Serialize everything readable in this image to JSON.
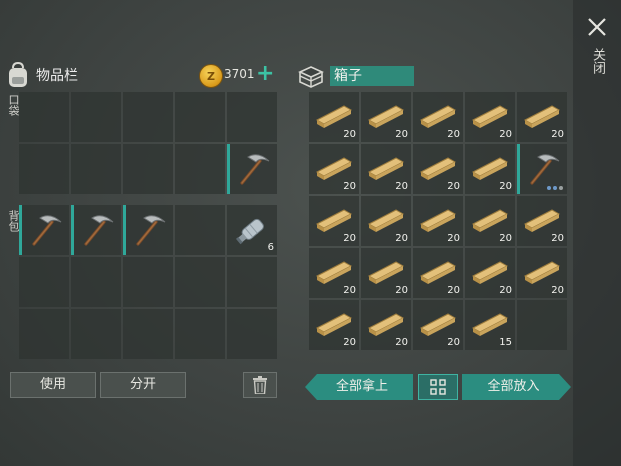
{
  "window": {
    "close_label": "关闭"
  },
  "inventory": {
    "title": "物品栏",
    "coins": "3701",
    "pocket_label": "口袋",
    "backpack_label": "背包",
    "pocket_slots": [
      {
        "item": ""
      },
      {
        "item": ""
      },
      {
        "item": ""
      },
      {
        "item": ""
      },
      {
        "item": ""
      },
      {
        "item": ""
      },
      {
        "item": ""
      },
      {
        "item": ""
      },
      {
        "item": ""
      },
      {
        "item": "pickaxe",
        "selected": true
      }
    ],
    "backpack_slots": [
      {
        "item": "pickaxe",
        "selected": true
      },
      {
        "item": "pickaxe",
        "selected": true
      },
      {
        "item": "pickaxe",
        "selected": true
      },
      {
        "item": ""
      },
      {
        "item": "water-bottle",
        "qty": "6"
      },
      {
        "item": ""
      },
      {
        "item": ""
      },
      {
        "item": ""
      },
      {
        "item": ""
      },
      {
        "item": ""
      },
      {
        "item": ""
      },
      {
        "item": ""
      },
      {
        "item": ""
      },
      {
        "item": ""
      },
      {
        "item": ""
      }
    ],
    "use_label": "使用",
    "split_label": "分开"
  },
  "chest": {
    "name": "箱子",
    "slots": [
      {
        "item": "plank",
        "qty": "20"
      },
      {
        "item": "plank",
        "qty": "20"
      },
      {
        "item": "plank",
        "qty": "20"
      },
      {
        "item": "plank",
        "qty": "20"
      },
      {
        "item": "plank",
        "qty": "20"
      },
      {
        "item": "plank",
        "qty": "20"
      },
      {
        "item": "plank",
        "qty": "20"
      },
      {
        "item": "plank",
        "qty": "20"
      },
      {
        "item": "plank",
        "qty": "20"
      },
      {
        "item": "pickaxe",
        "selected": true,
        "dots": true
      },
      {
        "item": "plank",
        "qty": "20"
      },
      {
        "item": "plank",
        "qty": "20"
      },
      {
        "item": "plank",
        "qty": "20"
      },
      {
        "item": "plank",
        "qty": "20"
      },
      {
        "item": "plank",
        "qty": "20"
      },
      {
        "item": "plank",
        "qty": "20"
      },
      {
        "item": "plank",
        "qty": "20"
      },
      {
        "item": "plank",
        "qty": "20"
      },
      {
        "item": "plank",
        "qty": "20"
      },
      {
        "item": "plank",
        "qty": "20"
      },
      {
        "item": "plank",
        "qty": "20"
      },
      {
        "item": "plank",
        "qty": "20"
      },
      {
        "item": "plank",
        "qty": "20"
      },
      {
        "item": "plank",
        "qty": "15"
      },
      {
        "item": ""
      }
    ],
    "take_all_label": "全部拿上",
    "put_all_label": "全部放入"
  },
  "colors": {
    "accent": "#2b8d80",
    "coin": "#e0a62a",
    "plus": "#3cc2a4"
  }
}
